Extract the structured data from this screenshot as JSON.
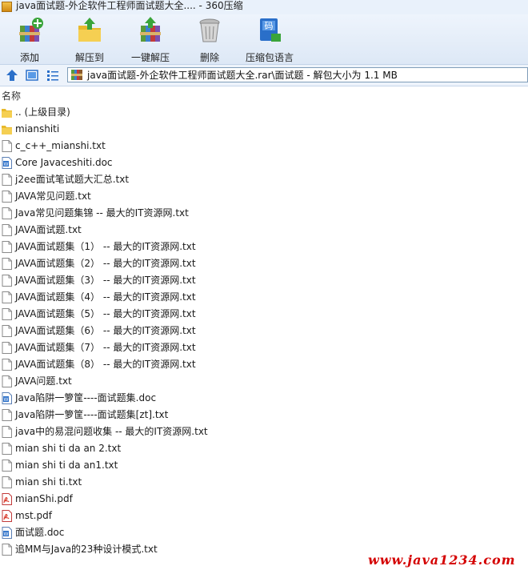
{
  "window": {
    "title": "java面试题-外企软件工程师面试题大全.... - 360压缩"
  },
  "toolbar": {
    "buttons": [
      {
        "id": "add",
        "label": "添加",
        "icon": "add-archive-icon"
      },
      {
        "id": "extract",
        "label": "解压到",
        "icon": "extract-folder-icon"
      },
      {
        "id": "oneclick",
        "label": "一键解压",
        "icon": "one-click-extract-icon"
      },
      {
        "id": "delete",
        "label": "删除",
        "icon": "trash-icon"
      },
      {
        "id": "lang",
        "label": "压缩包语言",
        "icon": "language-code-icon"
      }
    ]
  },
  "address": {
    "path": "java面试题-外企软件工程师面试题大全.rar\\面试题 - 解包大小为 1.1 MB"
  },
  "list": {
    "header_name": "名称",
    "items": [
      {
        "name": ".. (上级目录)",
        "type": "folder"
      },
      {
        "name": "mianshiti",
        "type": "folder"
      },
      {
        "name": "c_c++_mianshi.txt",
        "type": "txt"
      },
      {
        "name": "Core Javaceshiti.doc",
        "type": "doc"
      },
      {
        "name": "j2ee面试笔试题大汇总.txt",
        "type": "txt"
      },
      {
        "name": "JAVA常见问题.txt",
        "type": "txt"
      },
      {
        "name": "Java常见问题集锦 -- 最大的IT资源网.txt",
        "type": "txt"
      },
      {
        "name": "JAVA面试题.txt",
        "type": "txt"
      },
      {
        "name": "JAVA面试题集（1） -- 最大的IT资源网.txt",
        "type": "txt"
      },
      {
        "name": "JAVA面试题集（2） -- 最大的IT资源网.txt",
        "type": "txt"
      },
      {
        "name": "JAVA面试题集（3） -- 最大的IT资源网.txt",
        "type": "txt"
      },
      {
        "name": "JAVA面试题集（4） -- 最大的IT资源网.txt",
        "type": "txt"
      },
      {
        "name": "JAVA面试题集（5） -- 最大的IT资源网.txt",
        "type": "txt"
      },
      {
        "name": "JAVA面试题集（6） -- 最大的IT资源网.txt",
        "type": "txt"
      },
      {
        "name": "JAVA面试题集（7） -- 最大的IT资源网.txt",
        "type": "txt"
      },
      {
        "name": "JAVA面试题集（8） -- 最大的IT资源网.txt",
        "type": "txt"
      },
      {
        "name": "JAVA问题.txt",
        "type": "txt"
      },
      {
        "name": "Java陷阱一箩筐----面试题集.doc",
        "type": "doc"
      },
      {
        "name": "Java陷阱一箩筐----面试题集[zt].txt",
        "type": "txt"
      },
      {
        "name": "java中的易混问题收集 -- 最大的IT资源网.txt",
        "type": "txt"
      },
      {
        "name": "mian shi ti da an 2.txt",
        "type": "txt"
      },
      {
        "name": "mian shi ti da an1.txt",
        "type": "txt"
      },
      {
        "name": "mian shi ti.txt",
        "type": "txt"
      },
      {
        "name": "mianShi.pdf",
        "type": "pdf"
      },
      {
        "name": "mst.pdf",
        "type": "pdf"
      },
      {
        "name": "面试题.doc",
        "type": "doc"
      },
      {
        "name": "追MM与Java的23种设计模式.txt",
        "type": "txt"
      }
    ]
  },
  "watermark": "www.java1234.com",
  "colors": {
    "accent": "#2a6fc9",
    "watermark": "#d40000",
    "folder": "#e8b92c",
    "pdf": "#d93a2b"
  }
}
